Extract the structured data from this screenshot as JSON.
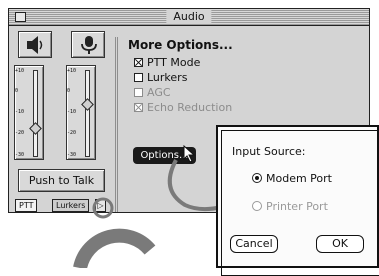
{
  "window": {
    "title": "Audio",
    "more_options": "More Options...",
    "speaker_icon": "speaker-icon",
    "microphone_icon": "microphone-icon",
    "slider_ticks": [
      "+10",
      "0",
      "-10",
      "-20",
      "-30"
    ],
    "push_to_talk": "Push to Talk",
    "tabs": [
      "PTT",
      "Lurkers"
    ],
    "tab_arrow": "▷",
    "options": [
      {
        "label": "PTT Mode",
        "checked": true,
        "enabled": true
      },
      {
        "label": "Lurkers",
        "checked": false,
        "enabled": true
      },
      {
        "label": "AGC",
        "checked": false,
        "enabled": false
      },
      {
        "label": "Echo Reduction",
        "checked": true,
        "enabled": false
      }
    ],
    "options_button": "Options..."
  },
  "dialog": {
    "label": "Input Source:",
    "radios": [
      {
        "label": "Modem Port",
        "selected": true,
        "enabled": true
      },
      {
        "label": "Printer Port",
        "selected": false,
        "enabled": false
      }
    ],
    "cancel": "Cancel",
    "ok": "OK"
  },
  "colors": {
    "window_bg": "#d4d4d4",
    "accent_dark": "#1a1a1a",
    "annotation_gray": "#7a7a7a"
  }
}
